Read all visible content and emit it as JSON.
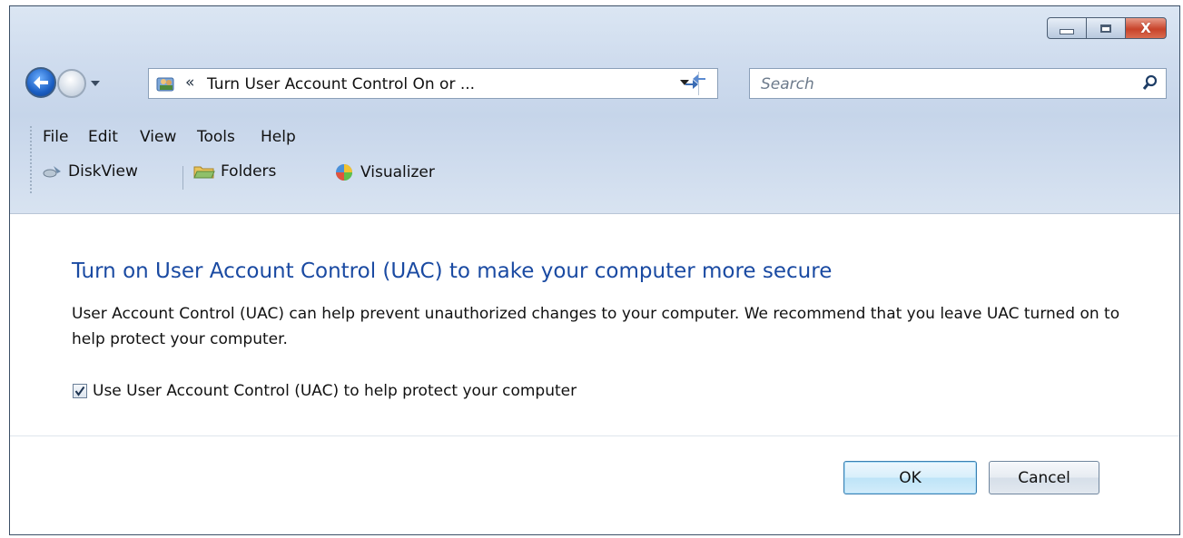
{
  "window": {
    "controls": {
      "minimize_icon": "minimize-icon",
      "maximize_icon": "maximize-icon",
      "close_glyph": "X"
    }
  },
  "nav": {
    "back_icon": "back-arrow-icon",
    "forward_icon": "forward-arrow-icon",
    "address": {
      "icon": "control-panel-users-icon",
      "chevron": "«",
      "text": "Turn User Account Control On or ..."
    },
    "refresh_icon": "refresh-icon",
    "search": {
      "placeholder": "Search",
      "icon": "search-icon"
    }
  },
  "menu": {
    "items": [
      "File",
      "Edit",
      "View",
      "Tools",
      "Help"
    ]
  },
  "toolbar": {
    "items": [
      {
        "label": "DiskView",
        "icon": "diskview-icon"
      },
      {
        "label": "Folders",
        "icon": "folders-icon"
      },
      {
        "label": "Visualizer",
        "icon": "visualizer-icon"
      }
    ]
  },
  "main": {
    "title": "Turn on User Account Control (UAC) to make your computer more secure",
    "description": "User Account Control (UAC) can help prevent unauthorized changes to your computer.  We recommend that you leave UAC turned on to help protect your computer.",
    "checkbox": {
      "label": "Use User Account Control (UAC) to help protect your computer",
      "checked": true
    }
  },
  "buttons": {
    "ok": "OK",
    "cancel": "Cancel"
  },
  "colors": {
    "title_blue": "#1a4aa2",
    "chrome": "#cfdcee",
    "close_red": "#c8432a"
  }
}
